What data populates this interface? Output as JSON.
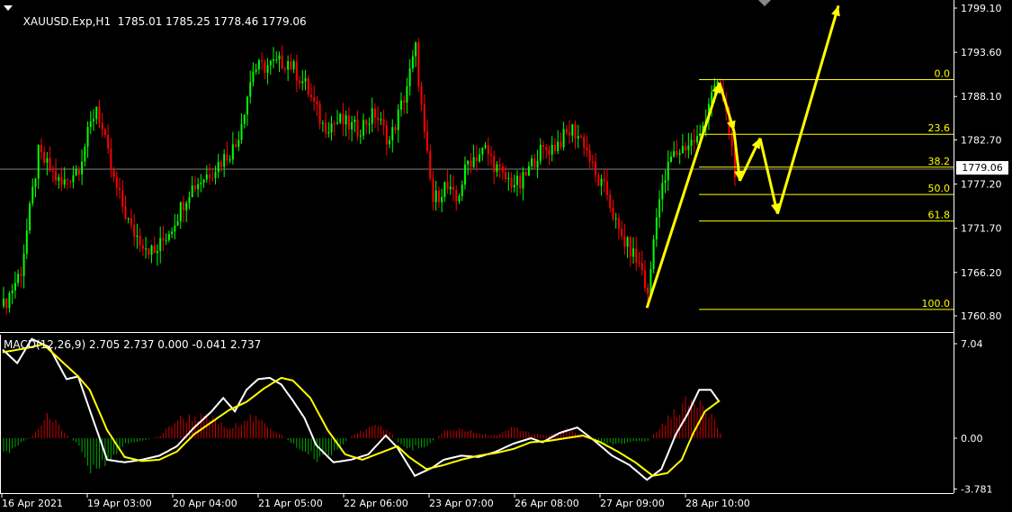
{
  "header": {
    "symbol": "XAUUSD.Exp,H1",
    "ohlc": "1785.01 1785.25 1778.46 1779.06"
  },
  "indicator": {
    "label": "MACD(12,26,9) 2.705 2.737 0.000 -0.041 2.737"
  },
  "current_price": "1779.06",
  "colors": {
    "bull": "#00ff00",
    "bear": "#ff0000",
    "fib": "#ffff00",
    "arrow": "#ffff00",
    "macd_line": "#ffffff",
    "signal_line": "#ffff00",
    "hist_pos": "#cc0000",
    "hist_neg": "#00aa00",
    "axis": "#ffffff",
    "grid": "#808080"
  },
  "chart_data": [
    {
      "type": "candlestick",
      "title": "XAUUSD.Exp,H1",
      "y_ticks": [
        "1799.10",
        "1793.60",
        "1788.10",
        "1782.70",
        "1777.20",
        "1771.70",
        "1766.20",
        "1760.80"
      ],
      "ylim": [
        1759.0,
        1800.7
      ],
      "current_price": 1779.06,
      "x_ticks": [
        "16 Apr 2021",
        "19 Apr 03:00",
        "20 Apr 04:00",
        "21 Apr 05:00",
        "22 Apr 06:00",
        "23 Apr 07:00",
        "26 Apr 08:00",
        "27 Apr 09:00",
        "28 Apr 10:00"
      ],
      "fibonacci": {
        "levels": [
          {
            "label": "0.0",
            "price": 1790.2
          },
          {
            "label": "23.6",
            "price": 1783.4
          },
          {
            "label": "38.2",
            "price": 1779.3
          },
          {
            "label": "50.0",
            "price": 1775.9
          },
          {
            "label": "61.8",
            "price": 1772.6
          },
          {
            "label": "100.0",
            "price": 1761.6
          }
        ]
      },
      "path_points": [
        {
          "bar": 222,
          "price": 1761.8
        },
        {
          "bar": 247,
          "price": 1789.8
        },
        {
          "bar": 252,
          "price": 1783.8
        },
        {
          "bar": 254,
          "price": 1777.6
        },
        {
          "bar": 261,
          "price": 1782.9
        },
        {
          "bar": 267,
          "price": 1773.5
        },
        {
          "bar": 288,
          "price": 1799.4
        }
      ],
      "price_trend": [
        [
          0,
          1762.0
        ],
        [
          6,
          1766.5
        ],
        [
          12,
          1781.0
        ],
        [
          20,
          1777.0
        ],
        [
          26,
          1779.5
        ],
        [
          32,
          1787.0
        ],
        [
          38,
          1777.5
        ],
        [
          44,
          1771.5
        ],
        [
          52,
          1768.5
        ],
        [
          58,
          1772.0
        ],
        [
          64,
          1776.5
        ],
        [
          72,
          1779.0
        ],
        [
          80,
          1782.0
        ],
        [
          86,
          1791.5
        ],
        [
          92,
          1792.0
        ],
        [
          98,
          1792.5
        ],
        [
          104,
          1789.5
        ],
        [
          110,
          1784.5
        ],
        [
          116,
          1785.0
        ],
        [
          122,
          1784.0
        ],
        [
          128,
          1786.0
        ],
        [
          133,
          1782.5
        ],
        [
          138,
          1788.0
        ],
        [
          142,
          1794.0
        ],
        [
          145,
          1783.0
        ],
        [
          148,
          1775.0
        ],
        [
          152,
          1777.0
        ],
        [
          156,
          1775.0
        ],
        [
          160,
          1780.0
        ],
        [
          166,
          1781.5
        ],
        [
          172,
          1778.0
        ],
        [
          178,
          1777.0
        ],
        [
          184,
          1781.0
        ],
        [
          190,
          1782.0
        ],
        [
          196,
          1784.0
        ],
        [
          200,
          1782.5
        ],
        [
          204,
          1778.0
        ],
        [
          208,
          1776.0
        ],
        [
          212,
          1771.0
        ],
        [
          216,
          1769.0
        ],
        [
          220,
          1766.5
        ],
        [
          222,
          1763.0
        ],
        [
          225,
          1774.0
        ],
        [
          230,
          1780.5
        ],
        [
          235,
          1782.0
        ],
        [
          240,
          1783.0
        ],
        [
          244,
          1789.0
        ],
        [
          247,
          1789.0
        ],
        [
          250,
          1784.0
        ],
        [
          252,
          1779.06
        ]
      ],
      "bar_count": 253
    },
    {
      "type": "line",
      "title": "MACD(12,26,9)",
      "y_ticks": [
        "7.04",
        "0.00",
        "-3.781"
      ],
      "ylim": [
        -3.781,
        7.04
      ],
      "series": [
        {
          "name": "MACD",
          "points": [
            [
              0,
              6.6
            ],
            [
              5,
              5.6
            ],
            [
              10,
              7.4
            ],
            [
              16,
              6.8
            ],
            [
              22,
              4.4
            ],
            [
              26,
              4.6
            ],
            [
              30,
              2.1
            ],
            [
              36,
              -1.6
            ],
            [
              42,
              -1.8
            ],
            [
              48,
              -1.6
            ],
            [
              54,
              -1.3
            ],
            [
              60,
              -0.6
            ],
            [
              66,
              0.8
            ],
            [
              72,
              2.0
            ],
            [
              76,
              3.0
            ],
            [
              80,
              2.0
            ],
            [
              84,
              3.6
            ],
            [
              88,
              4.4
            ],
            [
              92,
              4.5
            ],
            [
              96,
              4.0
            ],
            [
              100,
              2.8
            ],
            [
              104,
              1.5
            ],
            [
              108,
              -0.5
            ],
            [
              114,
              -1.8
            ],
            [
              120,
              -1.6
            ],
            [
              126,
              -1.2
            ],
            [
              132,
              0.2
            ],
            [
              136,
              -0.7
            ],
            [
              142,
              -2.8
            ],
            [
              148,
              -2.2
            ],
            [
              152,
              -1.6
            ],
            [
              158,
              -1.3
            ],
            [
              164,
              -1.4
            ],
            [
              170,
              -1.0
            ],
            [
              176,
              -0.4
            ],
            [
              182,
              0.0
            ],
            [
              186,
              -0.3
            ],
            [
              192,
              0.4
            ],
            [
              198,
              0.8
            ],
            [
              204,
              -0.2
            ],
            [
              210,
              -1.3
            ],
            [
              216,
              -2.0
            ],
            [
              222,
              -3.1
            ],
            [
              227,
              -2.3
            ],
            [
              232,
              0.3
            ],
            [
              236,
              1.8
            ],
            [
              240,
              3.6
            ],
            [
              244,
              3.6
            ],
            [
              247,
              2.7
            ]
          ]
        },
        {
          "name": "Signal",
          "points": [
            [
              0,
              6.4
            ],
            [
              8,
              6.7
            ],
            [
              14,
              7.0
            ],
            [
              20,
              5.8
            ],
            [
              26,
              4.6
            ],
            [
              30,
              3.6
            ],
            [
              36,
              0.6
            ],
            [
              42,
              -1.4
            ],
            [
              48,
              -1.7
            ],
            [
              54,
              -1.6
            ],
            [
              60,
              -1.0
            ],
            [
              66,
              0.3
            ],
            [
              72,
              1.2
            ],
            [
              78,
              2.1
            ],
            [
              84,
              2.7
            ],
            [
              90,
              3.7
            ],
            [
              96,
              4.5
            ],
            [
              100,
              4.3
            ],
            [
              106,
              3.0
            ],
            [
              112,
              0.6
            ],
            [
              118,
              -1.2
            ],
            [
              124,
              -1.6
            ],
            [
              130,
              -1.1
            ],
            [
              136,
              -0.6
            ],
            [
              140,
              -1.4
            ],
            [
              146,
              -2.3
            ],
            [
              152,
              -2.0
            ],
            [
              158,
              -1.6
            ],
            [
              164,
              -1.3
            ],
            [
              170,
              -1.1
            ],
            [
              176,
              -0.8
            ],
            [
              182,
              -0.3
            ],
            [
              188,
              -0.2
            ],
            [
              194,
              0.0
            ],
            [
              200,
              0.2
            ],
            [
              206,
              -0.3
            ],
            [
              212,
              -1.0
            ],
            [
              218,
              -1.8
            ],
            [
              224,
              -2.8
            ],
            [
              229,
              -2.6
            ],
            [
              234,
              -1.6
            ],
            [
              238,
              0.4
            ],
            [
              242,
              2.0
            ],
            [
              247,
              2.8
            ]
          ]
        }
      ],
      "histogram_trend": [
        [
          0,
          -1.2
        ],
        [
          10,
          0.2
        ],
        [
          16,
          1.8
        ],
        [
          20,
          0.5
        ],
        [
          26,
          -0.5
        ],
        [
          30,
          -2.2
        ],
        [
          36,
          -1.6
        ],
        [
          42,
          -0.4
        ],
        [
          48,
          -0.2
        ],
        [
          54,
          0.2
        ],
        [
          60,
          1.4
        ],
        [
          66,
          1.6
        ],
        [
          72,
          1.4
        ],
        [
          78,
          0.6
        ],
        [
          84,
          1.6
        ],
        [
          90,
          1.1
        ],
        [
          96,
          0.2
        ],
        [
          102,
          -0.8
        ],
        [
          108,
          -1.5
        ],
        [
          114,
          -1.0
        ],
        [
          120,
          0.2
        ],
        [
          126,
          0.8
        ],
        [
          132,
          0.8
        ],
        [
          136,
          -0.3
        ],
        [
          140,
          -0.8
        ],
        [
          146,
          -0.5
        ],
        [
          152,
          0.5
        ],
        [
          158,
          0.7
        ],
        [
          164,
          0.3
        ],
        [
          170,
          0.2
        ],
        [
          176,
          0.8
        ],
        [
          182,
          0.3
        ],
        [
          188,
          0.2
        ],
        [
          194,
          0.6
        ],
        [
          198,
          0.3
        ],
        [
          204,
          -0.2
        ],
        [
          210,
          -0.4
        ],
        [
          216,
          -0.3
        ],
        [
          222,
          -0.2
        ],
        [
          228,
          1.2
        ],
        [
          234,
          2.4
        ],
        [
          240,
          3.0
        ],
        [
          244,
          1.7
        ],
        [
          247,
          0.4
        ]
      ]
    }
  ]
}
